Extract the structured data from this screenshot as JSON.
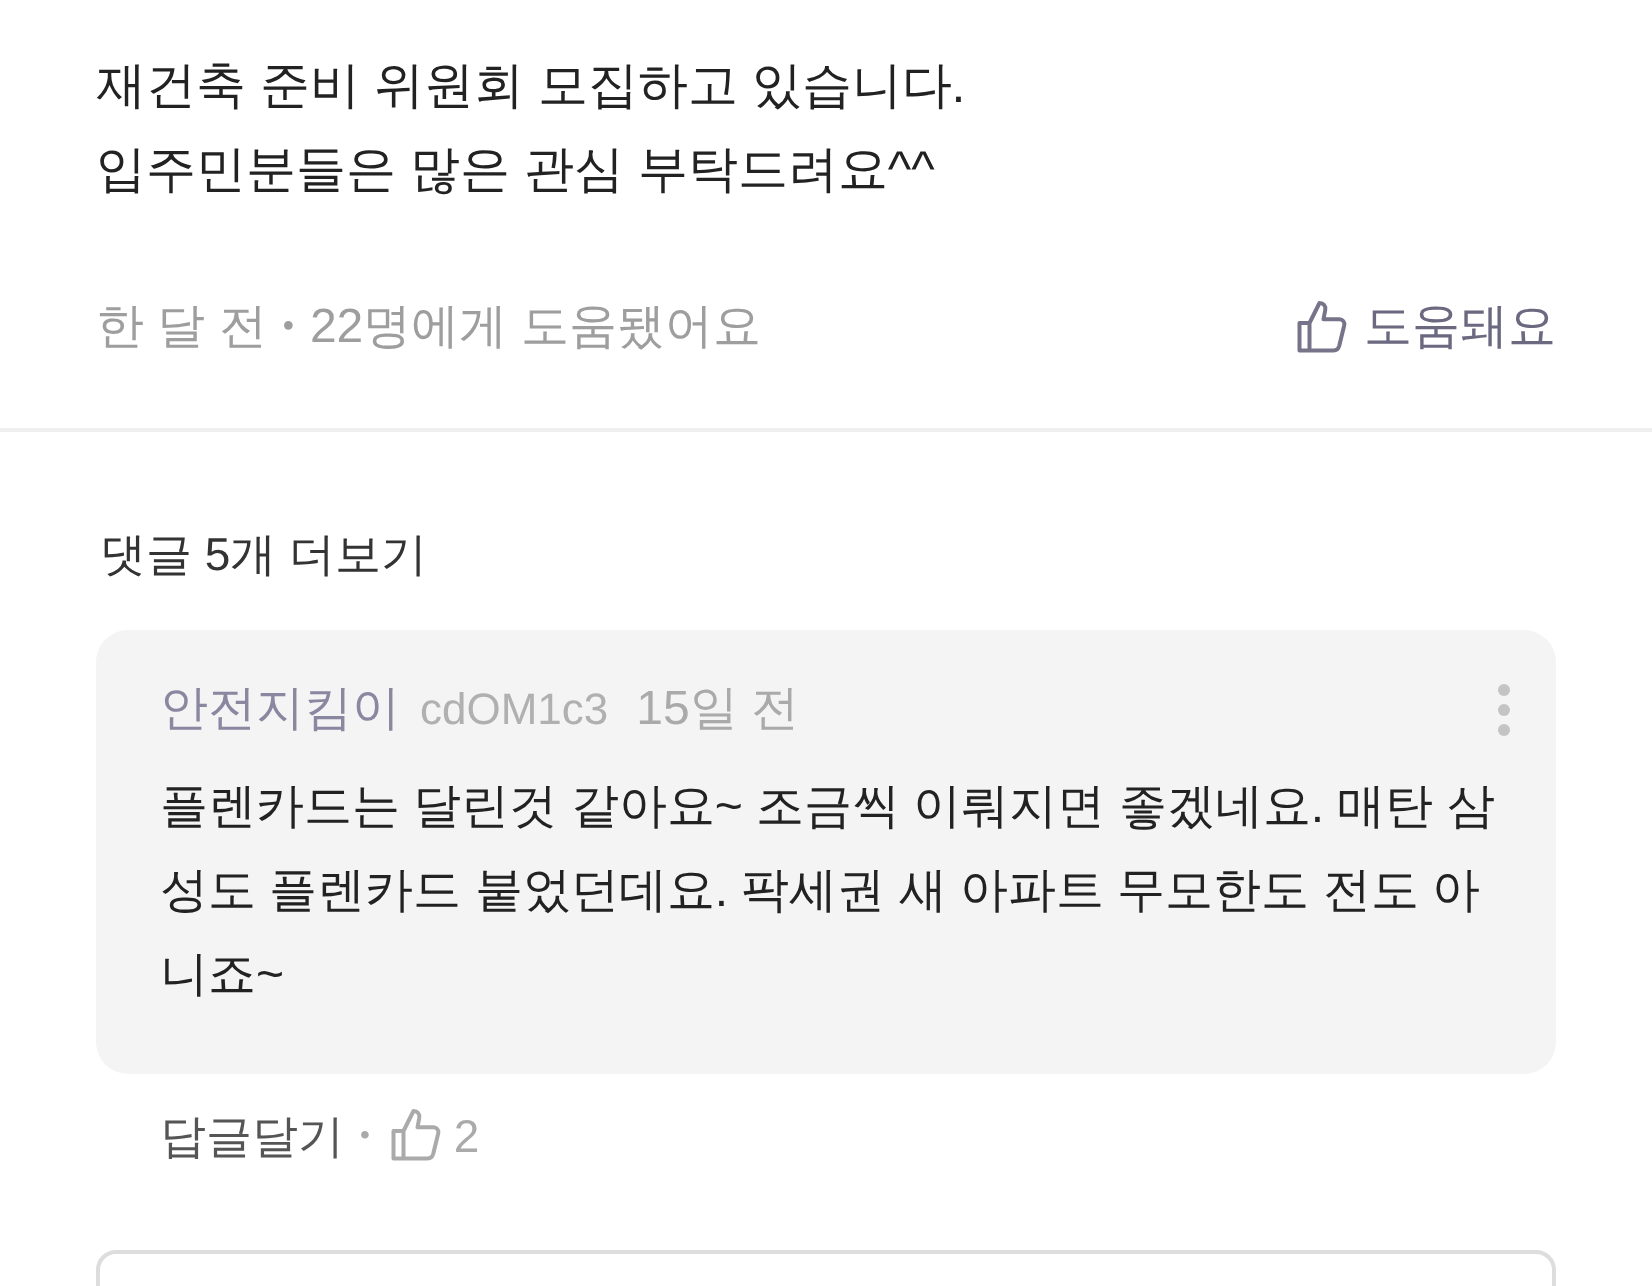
{
  "post": {
    "lines": [
      "재건축 준비 위원회 모집하고 있습니다.",
      "입주민분들은 많은 관심 부탁드려요^^"
    ],
    "time": "한 달 전",
    "separator": "•",
    "helped": "22명에게 도움됐어요",
    "help_button": {
      "label": "도움돼요",
      "selected": false
    }
  },
  "comments_link": "댓글 5개 더보기",
  "comments": [
    {
      "author": "안전지킴이",
      "user_id": "cdOM1c3",
      "time": "15일 전",
      "body": "플렌카드는 달린것 같아요~ 조금씩 이뤄지면 좋겠네요. 매탄 삼성도 플렌카드 붙었던데요. 팍세권 새 아파트 무모한도 전도 아니죠~",
      "reply": "답글달기",
      "separator": "•",
      "likes": "2",
      "liked": false
    }
  ]
}
